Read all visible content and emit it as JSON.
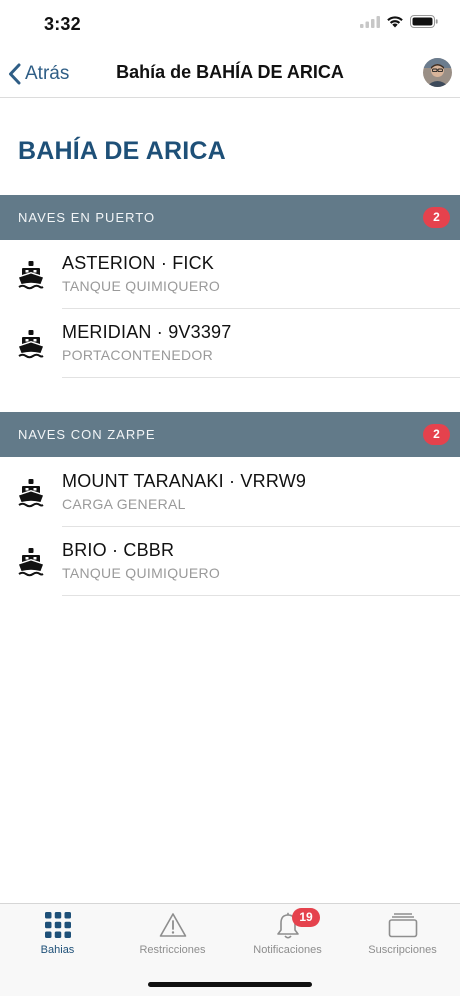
{
  "status_bar": {
    "time": "3:32"
  },
  "nav": {
    "back_label": "Atrás",
    "title": "Bahía de BAHÍA DE ARICA"
  },
  "page_title": "BAHÍA DE ARICA",
  "sections": [
    {
      "title": "NAVES EN PUERTO",
      "count": "2",
      "ships": [
        {
          "name": "ASTERION · FICK",
          "type": "TANQUE QUIMIQUERO"
        },
        {
          "name": "MERIDIAN · 9V3397",
          "type": "PORTACONTENEDOR"
        }
      ]
    },
    {
      "title": "NAVES CON ZARPE",
      "count": "2",
      "ships": [
        {
          "name": "MOUNT TARANAKI · VRRW9",
          "type": "CARGA GENERAL"
        },
        {
          "name": "BRIO · CBBR",
          "type": "TANQUE QUIMIQUERO"
        }
      ]
    }
  ],
  "tab_bar": {
    "tabs": [
      {
        "label": "Bahias",
        "icon": "grid-icon",
        "active": true
      },
      {
        "label": "Restricciones",
        "icon": "warning-icon",
        "active": false
      },
      {
        "label": "Notificaciones",
        "icon": "bell-icon",
        "active": false,
        "badge": "19"
      },
      {
        "label": "Suscripciones",
        "icon": "stack-icon",
        "active": false
      }
    ]
  },
  "colors": {
    "accent": "#1e5078",
    "section_header_bg": "#627a89",
    "badge": "#e5424d"
  }
}
